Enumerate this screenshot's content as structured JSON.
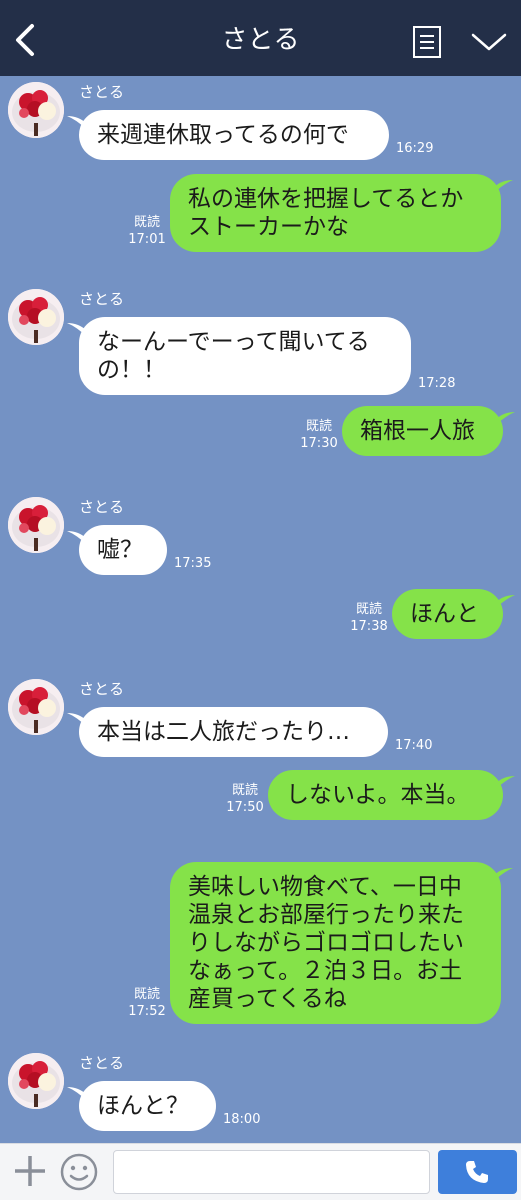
{
  "header": {
    "title": "さとる",
    "back_icon": "chevron-left-icon",
    "memo_icon": "note-list-icon",
    "menu_icon": "chevron-down-icon"
  },
  "colors": {
    "background": "#7492c4",
    "header": "#232f48",
    "incoming_bubble": "#ffffff",
    "outgoing_bubble": "#85e249",
    "call_button": "#3e7fdb"
  },
  "messages": [
    {
      "direction": "in",
      "sender": "さとる",
      "text": "来週連休取ってるの何で",
      "time": "16:29"
    },
    {
      "direction": "out",
      "text": "私の連休を把握してるとか\nストーカーかな",
      "read": "既読",
      "time": "17:01"
    },
    {
      "direction": "in",
      "sender": "さとる",
      "text": "なーんーでーって聞いてる\nの！！",
      "time": "17:28"
    },
    {
      "direction": "out",
      "text": "箱根一人旅",
      "read": "既読",
      "time": "17:30"
    },
    {
      "direction": "in",
      "sender": "さとる",
      "text": "嘘？",
      "time": "17:35"
    },
    {
      "direction": "out",
      "text": "ほんと",
      "read": "既読",
      "time": "17:38"
    },
    {
      "direction": "in",
      "sender": "さとる",
      "text": "本当は二人旅だったり…",
      "time": "17:40"
    },
    {
      "direction": "out",
      "text": "しないよ。本当。",
      "read": "既読",
      "time": "17:50"
    },
    {
      "direction": "out",
      "text": "美味しい物食べて、一日中\n温泉とお部屋行ったり来た\nりしながらゴロゴロしたい\nなぁって。２泊３日。お土\n産買ってくるね",
      "read": "既読",
      "time": "17:52"
    },
    {
      "direction": "in",
      "sender": "さとる",
      "text": "ほんと？",
      "time": "18:00"
    }
  ],
  "bottom_bar": {
    "plus_icon": "plus-icon",
    "emoji_icon": "smiley-icon",
    "input_value": "",
    "call_icon": "phone-icon"
  }
}
